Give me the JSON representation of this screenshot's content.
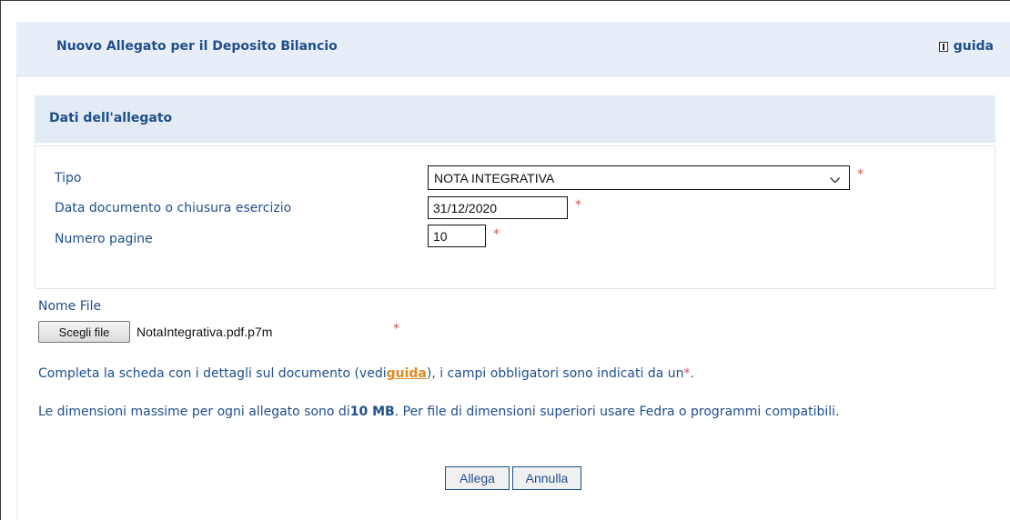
{
  "header": {
    "title": "Nuovo Allegato per il Deposito Bilancio",
    "guida_label": "guida"
  },
  "section": {
    "title": "Dati dell'allegato"
  },
  "form": {
    "tipo_label": "Tipo",
    "tipo_value": "NOTA INTEGRATIVA",
    "data_label": "Data documento o chiusura esercizio",
    "data_value": "31/12/2020",
    "pagine_label": "Numero pagine",
    "pagine_value": "10",
    "required_mark": "*",
    "file_label": "Nome File",
    "file_button": "Scegli file",
    "file_name": "NotaIntegrativa.pdf.p7m"
  },
  "info": {
    "line1_pre": "Completa la scheda con i dettagli sul documento (vedi",
    "line1_link": "guida",
    "line1_mid": "), i campi obbligatori sono indicati da un",
    "line1_req": "*",
    "line1_end": ".",
    "line2_pre": "Le dimensioni massime per ogni allegato sono di",
    "line2_bold": "10 MB",
    "line2_post": ". Per file di dimensioni superiori usare Fedra o programmi compatibili."
  },
  "actions": {
    "allega": "Allega",
    "annulla": "Annulla"
  }
}
